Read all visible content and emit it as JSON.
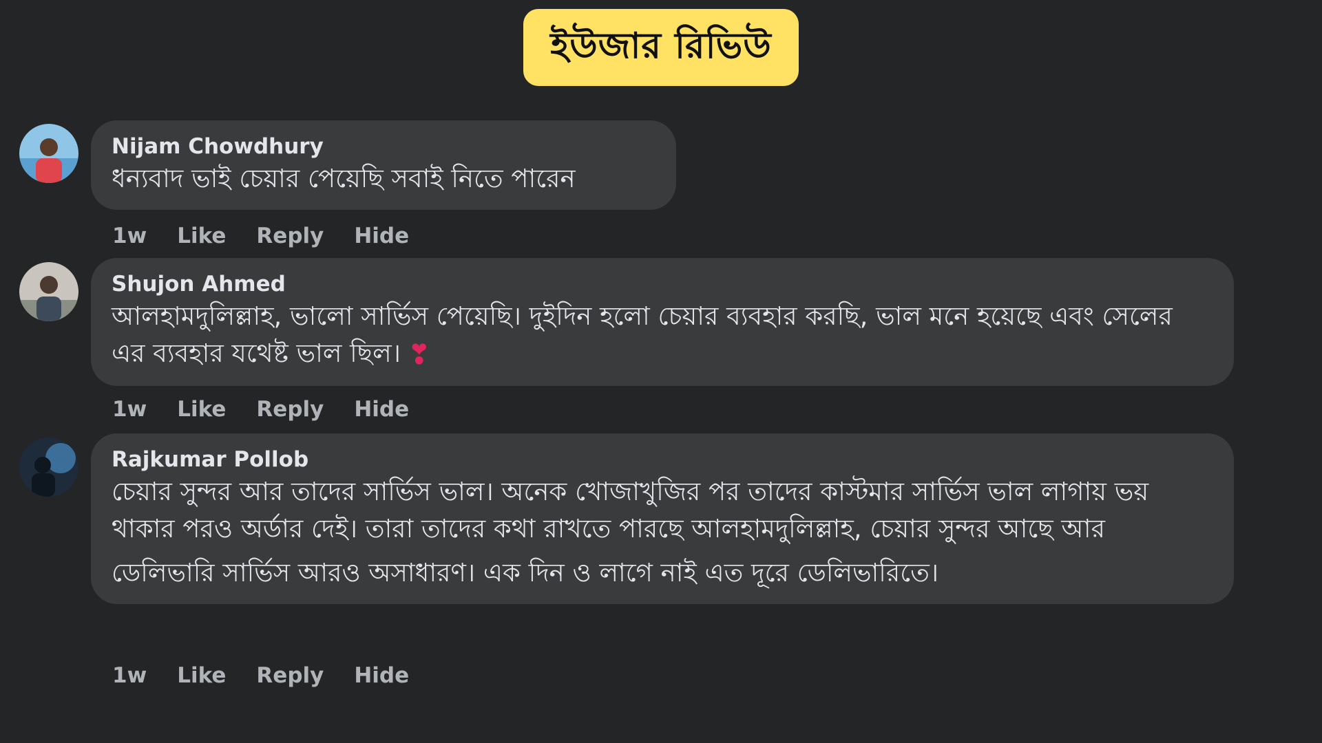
{
  "header": {
    "title": "ইউজার রিভিউ"
  },
  "comments": [
    {
      "author": "Nijam Chowdhury",
      "lines": [
        "ধন্যবাদ ভাই চেয়ার পেয়েছি সবাই নিতে পারেন"
      ],
      "time": "1w",
      "like": "Like",
      "reply": "Reply",
      "hide": "Hide"
    },
    {
      "author": "Shujon Ahmed",
      "lines": [
        "আলহামদুলিল্লাহ, ভালো সার্ভিস পেয়েছি। দুইদিন হলো চেয়ার ব্যবহার করছি, ভাল মনে হয়েছে এবং সেলের এর ব্যবহার যথেষ্ট ভাল ছিল।"
      ],
      "emoji": "❣",
      "time": "1w",
      "like": "Like",
      "reply": "Reply",
      "hide": "Hide"
    },
    {
      "author": "Rajkumar Pollob",
      "lines": [
        "চেয়ার সুন্দর আর তাদের সার্ভিস ভাল। অনেক খোজাখুজির পর তাদের কাস্টমার সার্ভিস ভাল লাগায় ভয় থাকার পরও অর্ডার দেই। তারা তাদের কথা রাখতে পারছে আলহামদুলিল্লাহ, চেয়ার সুন্দর আছে আর",
        "ডেলিভারি সার্ভিস আরও অসাধারণ। এক দিন ও লাগে নাই এত দূরে ডেলিভারিতে।"
      ],
      "time": "1w",
      "like": "Like",
      "reply": "Reply",
      "hide": "Hide"
    }
  ],
  "colors": {
    "background": "#242526",
    "bubble": "#3a3b3c",
    "badge": "#ffe164",
    "text": "#e4e6eb",
    "muted": "#b0b3b8"
  }
}
